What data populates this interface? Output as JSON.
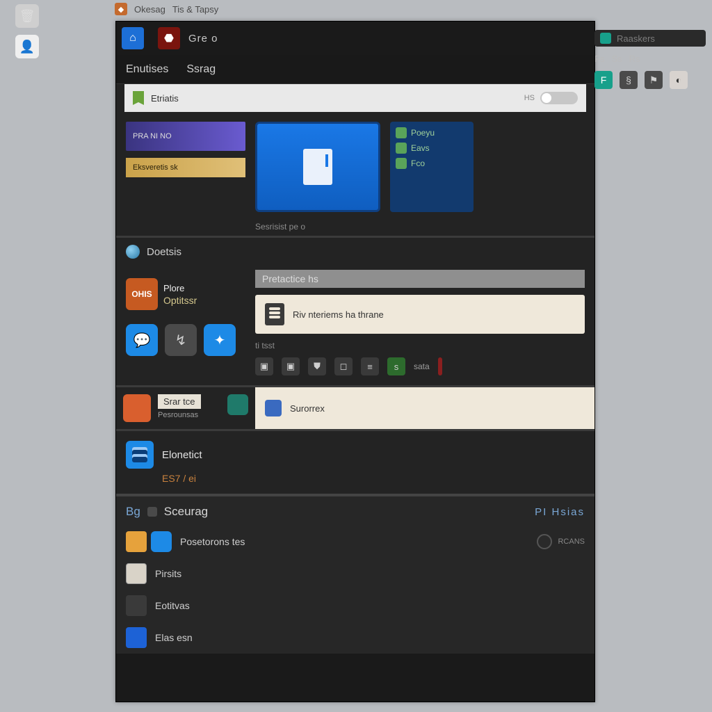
{
  "desktop": {
    "icon1_name": "recycle-bin-icon",
    "icon2_name": "user-avatar-icon"
  },
  "titlebar": {
    "app": "Okesag",
    "doc": "Tis & Tapsy"
  },
  "tabs": {
    "tab1_label": "Gre o"
  },
  "subbar": {
    "item1": "Enutises",
    "item2": "Ssrag"
  },
  "top_right": {
    "chip": "Raaskers",
    "m1": "Fs",
    "m2": "Ss",
    "m3": "Rs"
  },
  "secA": {
    "header": "Etriatis",
    "toggle_label": "HS",
    "promo1": "PRA NI NO",
    "promo2": "Eksveretis sk",
    "caption": "Sesrisist pe o",
    "side": {
      "r1": "Poeyu",
      "r2": "Eavs",
      "r3": "Fco"
    }
  },
  "secB": {
    "header": "Doetsis",
    "cat_badge": "OHIS",
    "cat_t1": "Plore",
    "cat_t2": "Optitssr",
    "right_header": "Pretactice hs",
    "feature": "Riv nteriems ha thrane",
    "sub_label": "ti tsst",
    "chip_label": "sata"
  },
  "rowC1": {
    "left_title": "Srar tce",
    "left_sub": "Pesrounsas",
    "right_label": "Surorrex"
  },
  "rowC2": {
    "title": "Elonetict",
    "sub": "ES7 / ei"
  },
  "secD": {
    "tab_a": "Bg",
    "tab_b": "Sceurag",
    "right": "PI Hsias",
    "items": [
      {
        "label": "Posetorons tes",
        "badge": "RCANS"
      },
      {
        "label": "Pirsits"
      },
      {
        "label": "Eotitvas"
      },
      {
        "label": "Elas esn"
      }
    ]
  }
}
